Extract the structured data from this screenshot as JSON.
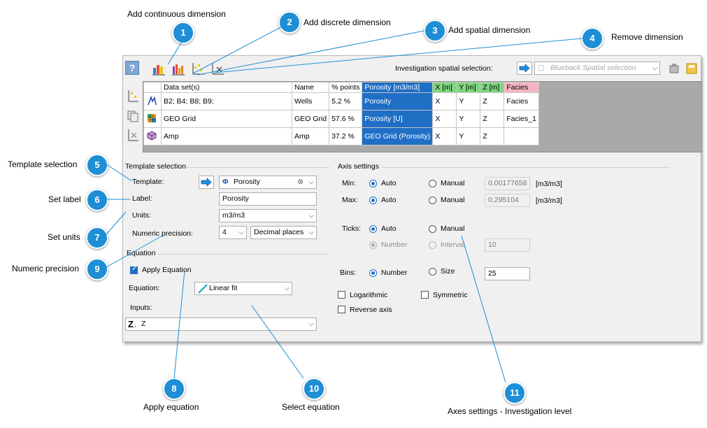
{
  "callouts": [
    {
      "number": "1",
      "label": "Add continuous dimension"
    },
    {
      "number": "2",
      "label": "Add discrete dimension"
    },
    {
      "number": "3",
      "label": "Add spatial dimension"
    },
    {
      "number": "4",
      "label": "Remove dimension"
    },
    {
      "number": "5",
      "label": "Template selection"
    },
    {
      "number": "6",
      "label": "Set label"
    },
    {
      "number": "7",
      "label": "Set units"
    },
    {
      "number": "9",
      "label": "Numeric precision"
    },
    {
      "number": "8",
      "label": "Apply equation"
    },
    {
      "number": "10",
      "label": "Select equation"
    },
    {
      "number": "11",
      "label": "Axes settings - Investigation level"
    }
  ],
  "toolbar": {
    "spatial_label": "Investigation spatial selection:",
    "spatial_placeholder": "Blueback Spatial selection"
  },
  "grid": {
    "headers": [
      "Data set(s)",
      "Name",
      "% points",
      "Porosity [m3/m3]",
      "X [m]",
      "Y [m]",
      "Z [m]",
      "Facies"
    ],
    "rows": [
      {
        "icon": "wells-icon",
        "dataset": "B2; B4; B8; B9;",
        "name": "Wells",
        "points": "5.2 %",
        "porosity": "Porosity",
        "x": "X",
        "y": "Y",
        "z": "Z",
        "facies": "Facies"
      },
      {
        "icon": "grid-icon",
        "dataset": "GEO Grid",
        "name": "GEO Grid",
        "points": "57.6 %",
        "porosity": "Porosity [U]",
        "x": "X",
        "y": "Y",
        "z": "Z",
        "facies": "Facies_1"
      },
      {
        "icon": "cube-icon",
        "dataset": "Amp",
        "name": "Amp",
        "points": "37.2 %",
        "porosity": "GEO Grid (Porosity)",
        "x": "X",
        "y": "Y",
        "z": "Z",
        "facies": ""
      }
    ]
  },
  "template": {
    "section": "Template selection",
    "template_label": "Template:",
    "template_value": "Porosity",
    "label_label": "Label:",
    "label_value": "Porosity",
    "units_label": "Units:",
    "units_value": "m3/m3",
    "precision_label": "Numeric precision:",
    "precision_value": "4",
    "precision_mode": "Decimal places"
  },
  "equation": {
    "section": "Equation",
    "apply_label": "Apply Equation",
    "apply_checked": true,
    "equation_label": "Equation:",
    "equation_value": "Linear fit",
    "inputs_label": "Inputs:",
    "inputs_value": "Z"
  },
  "axis": {
    "section": "Axis settings",
    "min_label": "Min:",
    "max_label": "Max:",
    "auto": "Auto",
    "manual": "Manual",
    "min_value": "0.00177658",
    "max_value": "0.295104",
    "unit": "[m3/m3]",
    "ticks_label": "Ticks:",
    "number": "Number",
    "interval": "Interval",
    "ticks_value": "10",
    "bins_label": "Bins:",
    "size": "Size",
    "bins_value": "25",
    "logarithmic": "Logarithmic",
    "symmetric": "Symmetric",
    "reverse": "Reverse axis"
  },
  "colors": {
    "accent": "#1f6fc5",
    "badge": "#1e8fd6",
    "green_header": "#7fd67f",
    "pink_header": "#f4b6c2"
  }
}
